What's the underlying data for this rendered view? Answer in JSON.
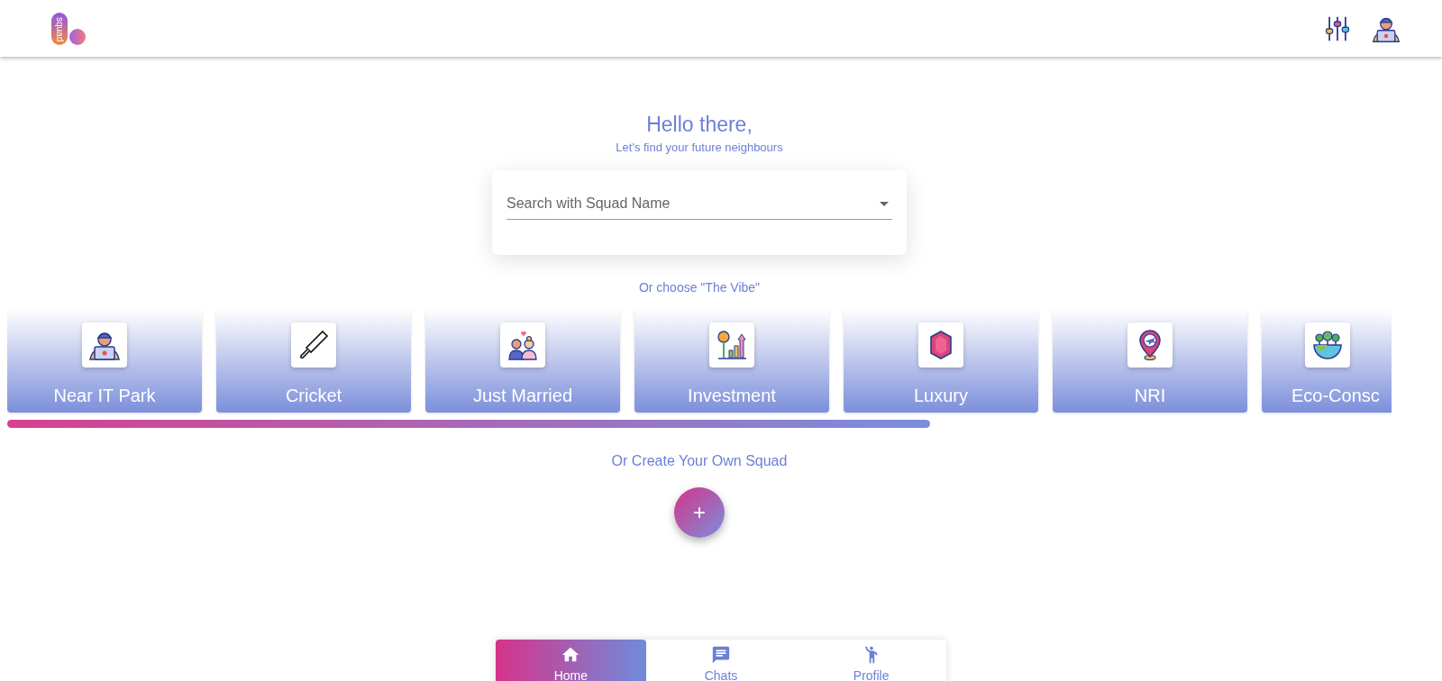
{
  "header": {
    "logo_text": "squad"
  },
  "greeting": {
    "title": "Hello there,",
    "subtitle": "Let's find your future neighbours"
  },
  "search": {
    "placeholder": "Search with Squad Name"
  },
  "vibe_prompt": "Or choose \"The Vibe\"",
  "vibes": [
    {
      "label": "Near IT Park",
      "kind": "developer"
    },
    {
      "label": "Cricket",
      "kind": "cricket"
    },
    {
      "label": "Just Married",
      "kind": "couple"
    },
    {
      "label": "Investment",
      "kind": "investment"
    },
    {
      "label": "Luxury",
      "kind": "gem"
    },
    {
      "label": "NRI",
      "kind": "travel"
    },
    {
      "label": "Eco-Consc",
      "kind": "eco"
    }
  ],
  "create_prompt": "Or Create Your Own Squad",
  "create_button": "+",
  "bottom_nav": [
    {
      "label": "Home",
      "kind": "home",
      "selected": true
    },
    {
      "label": "Chats",
      "kind": "chat",
      "selected": false
    },
    {
      "label": "Profile",
      "kind": "person",
      "selected": false
    }
  ]
}
